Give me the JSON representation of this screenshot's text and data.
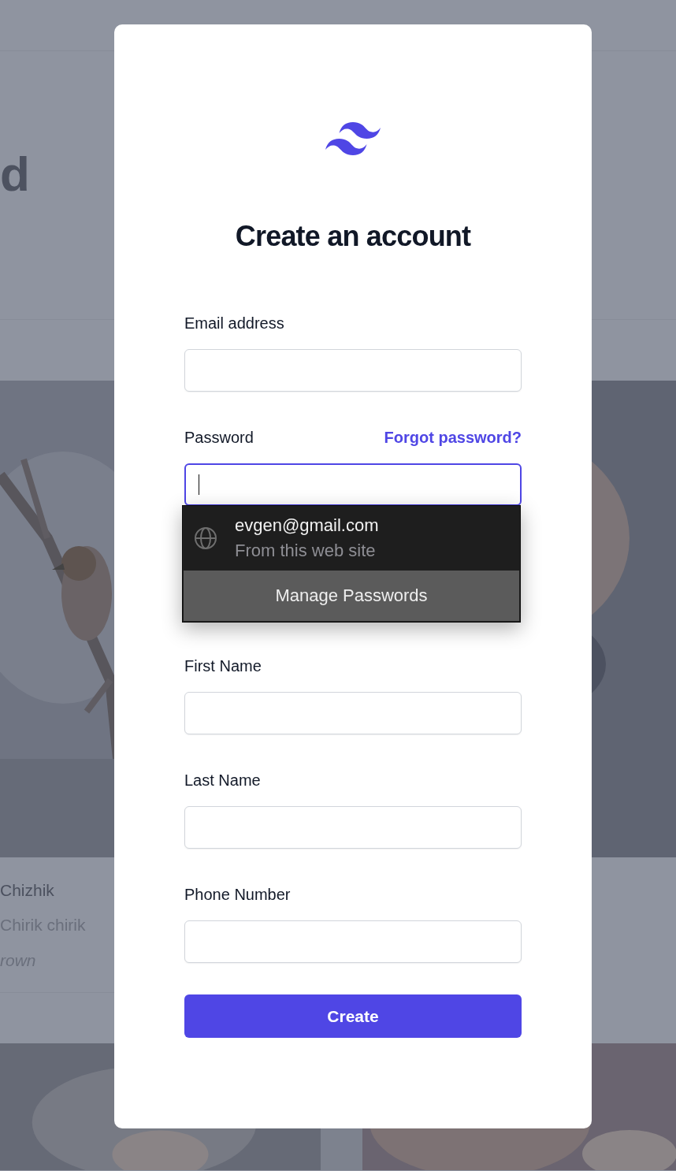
{
  "background": {
    "heading": "d",
    "caption": {
      "title": "Chizhik",
      "subtitle": "Chirik chirik",
      "tag": "rown"
    }
  },
  "dialog": {
    "title": "Create an account",
    "fields": [
      {
        "label": "Email address",
        "focused": false
      },
      {
        "label": "Password",
        "link": "Forgot password?",
        "focused": true
      },
      {
        "kind": "hidden"
      },
      {
        "label": "First Name",
        "focused": false
      },
      {
        "label": "Last Name",
        "focused": false
      },
      {
        "label": "Phone Number",
        "focused": false
      }
    ],
    "submit": "Create"
  },
  "autofill": {
    "entries": [
      {
        "username": "evgen@gmail.com",
        "source": "From this web site"
      }
    ],
    "action": "Manage Passwords"
  }
}
